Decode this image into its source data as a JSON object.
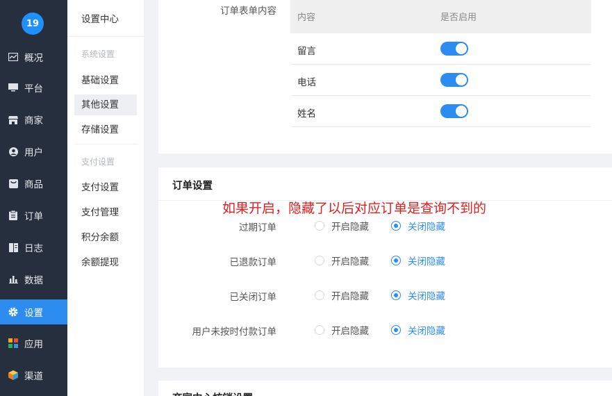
{
  "brand": {
    "logo_text": "19"
  },
  "nav": {
    "items": [
      {
        "label": "概况",
        "icon": "overview-chart-icon"
      },
      {
        "label": "平台",
        "icon": "monitor-icon"
      },
      {
        "label": "商家",
        "icon": "store-icon"
      },
      {
        "label": "用户",
        "icon": "user-icon"
      },
      {
        "label": "商品",
        "icon": "product-icon"
      },
      {
        "label": "订单",
        "icon": "clipboard-icon"
      },
      {
        "label": "日志",
        "icon": "book-icon"
      },
      {
        "label": "数据",
        "icon": "bar-chart-icon"
      },
      {
        "label": "设置",
        "icon": "gear-icon",
        "active": true
      },
      {
        "label": "应用",
        "icon": "apps-grid-icon"
      },
      {
        "label": "渠道",
        "icon": "cube-icon"
      }
    ],
    "active_color": "#2d8cf0"
  },
  "submenu": {
    "title": "设置中心",
    "group1": "系统设置",
    "group1_items": [
      "基础设置",
      "其他设置",
      "存储设置"
    ],
    "group2": "支付设置",
    "group2_items": [
      "支付设置",
      "支付管理",
      "积分余额",
      "余额提现"
    ],
    "active": "其他设置"
  },
  "order_form": {
    "label": "订单表单内容",
    "columns": [
      "内容",
      "是否启用"
    ],
    "rows": [
      {
        "name": "留言",
        "enabled": true
      },
      {
        "name": "电话",
        "enabled": true
      },
      {
        "name": "姓名",
        "enabled": true
      }
    ]
  },
  "order_settings": {
    "title": "订单设置",
    "note": "如果开启，隐藏了以后对应订单是查询不到的",
    "option_on": "开启隐藏",
    "option_off": "关闭隐藏",
    "rows": [
      {
        "label": "过期订单",
        "selected": "关闭隐藏"
      },
      {
        "label": "已退款订单",
        "selected": "关闭隐藏"
      },
      {
        "label": "已关闭订单",
        "selected": "关闭隐藏"
      },
      {
        "label": "用户未按时付款订单",
        "selected": "关闭隐藏"
      }
    ]
  },
  "next_section": {
    "title": "商家中心核销设置"
  }
}
